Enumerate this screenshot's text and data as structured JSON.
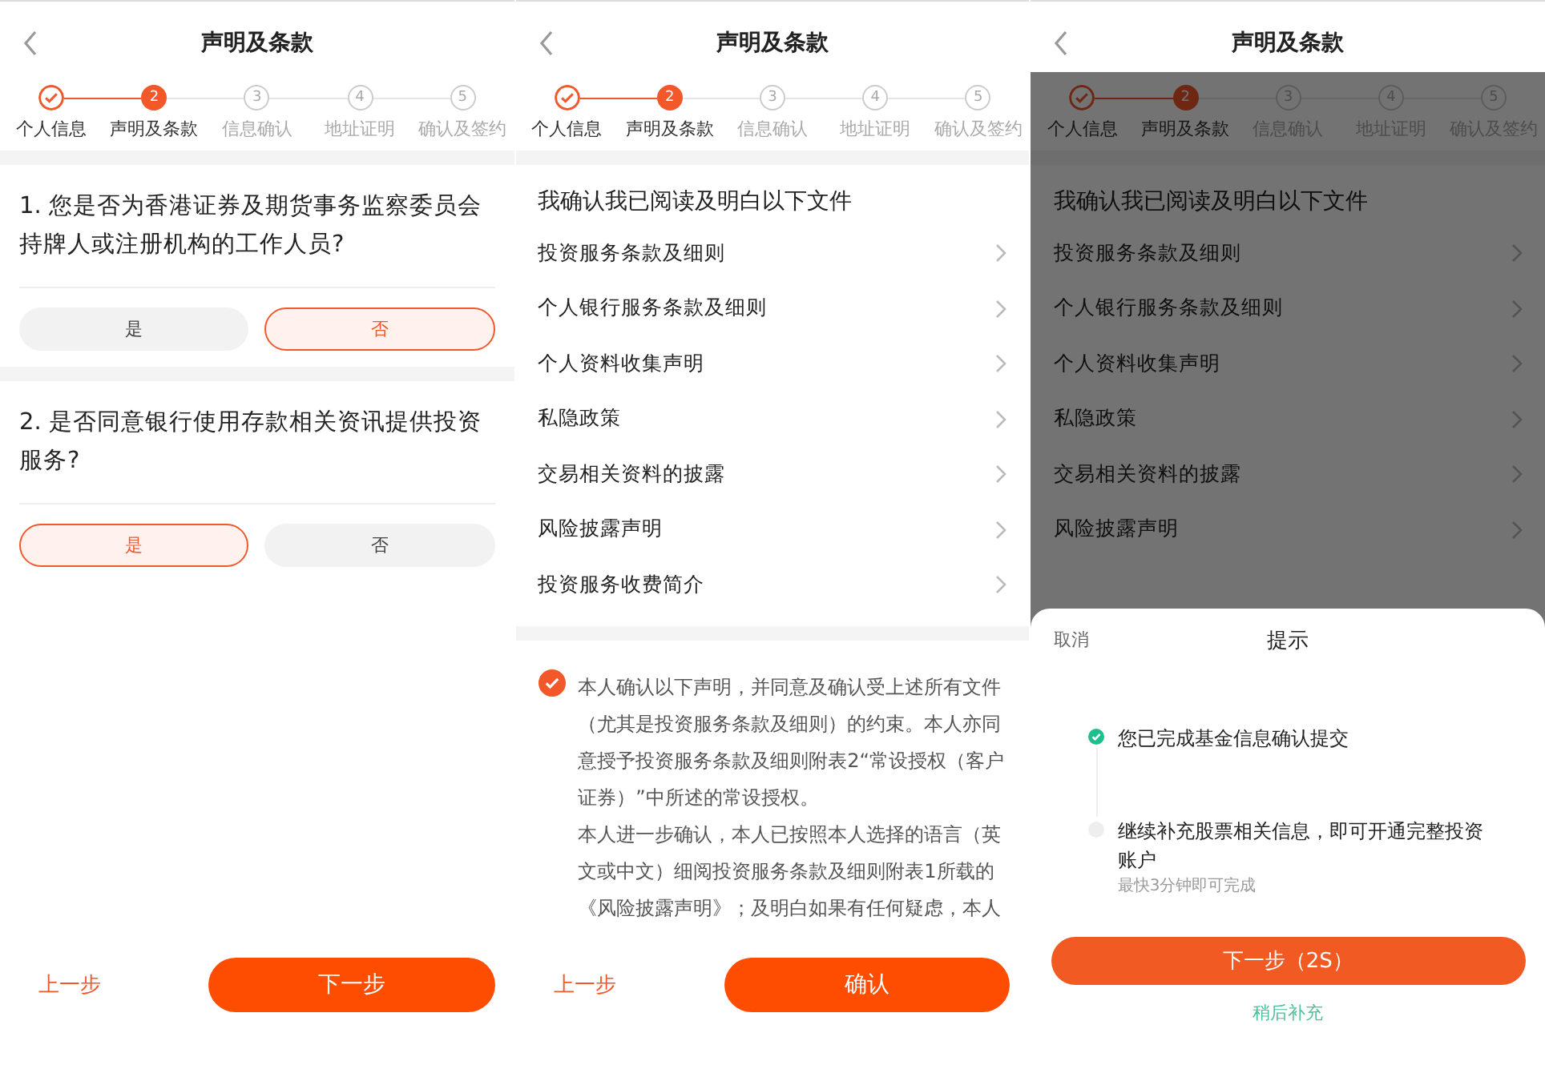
{
  "screens": [
    {
      "title": "声明及条款",
      "steps": [
        {
          "label": "个人信息",
          "completed": true,
          "selected": false
        },
        {
          "label": "声明及条款",
          "number": "2",
          "completed": false,
          "selected": true
        },
        {
          "label": "信息确认",
          "number": "3",
          "completed": false,
          "selected": false
        },
        {
          "label": "地址证明",
          "number": "4",
          "completed": false,
          "selected": false
        },
        {
          "label": "确认及签约",
          "number": "5",
          "completed": false,
          "selected": false
        }
      ],
      "body": {
        "kind": "questions",
        "questions": [
          {
            "text": "1. 您是否为香港证券及期货事务监察委员会持牌人或注册机构的工作人员?",
            "options": [
              {
                "label": "是",
                "selected": false
              },
              {
                "label": "否",
                "selected": true
              }
            ]
          },
          {
            "text": "2. 是否同意银行使用存款相关资讯提供投资服务?",
            "options": [
              {
                "label": "是",
                "selected": true
              },
              {
                "label": "否",
                "selected": false
              }
            ]
          }
        ]
      },
      "footer": {
        "back": "上一步",
        "next": "下一步"
      }
    },
    {
      "title": "声明及条款",
      "steps": [
        {
          "label": "个人信息",
          "completed": true,
          "selected": false
        },
        {
          "label": "声明及条款",
          "number": "2",
          "completed": false,
          "selected": true
        },
        {
          "label": "信息确认",
          "number": "3",
          "completed": false,
          "selected": false
        },
        {
          "label": "地址证明",
          "number": "4",
          "completed": false,
          "selected": false
        },
        {
          "label": "确认及签约",
          "number": "5",
          "completed": false,
          "selected": false
        }
      ],
      "body": {
        "kind": "documents",
        "heading": "我确认我已阅读及明白以下文件",
        "documents": [
          "投资服务条款及细则",
          "个人银行服务条款及细则",
          "个人资料收集声明",
          "私隐政策",
          "交易相关资料的披露",
          "风险披露声明",
          "投资服务收费简介"
        ],
        "consent": {
          "checked": true,
          "paragraphs": [
            "本人确认以下声明，并同意及确认受上述所有文件（尤其是投资服务条款及细则）的约束。本人亦同意授予投资服务条款及细则附表2“常设授权（客户证券）”中所述的常设授权。",
            "本人进一步确认，本人已按照本人选择的语言（英文或中文）细阅投资服务条款及细则附表1所载的《风险披露声明》；及明白如果有任何疑虑，本人"
          ]
        }
      },
      "footer": {
        "back": "上一步",
        "next": "确认"
      }
    },
    {
      "title": "声明及条款",
      "steps": [
        {
          "label": "个人信息",
          "completed": true,
          "selected": false
        },
        {
          "label": "声明及条款",
          "number": "2",
          "completed": false,
          "selected": true
        },
        {
          "label": "信息确认",
          "number": "3",
          "completed": false,
          "selected": false
        },
        {
          "label": "地址证明",
          "number": "4",
          "completed": false,
          "selected": false
        },
        {
          "label": "确认及签约",
          "number": "5",
          "completed": false,
          "selected": false
        }
      ],
      "body": {
        "kind": "documents",
        "heading": "我确认我已阅读及明白以下文件",
        "documents": [
          "投资服务条款及细则",
          "个人银行服务条款及细则",
          "个人资料收集声明",
          "私隐政策",
          "交易相关资料的披露",
          "风险披露声明"
        ]
      },
      "dialog": {
        "cancel": "取消",
        "title": "提示",
        "items": [
          {
            "text": "您已完成基金信息确认提交",
            "done": true
          },
          {
            "text": "继续补充股票相关信息，即可开通完整投资账户",
            "note": "最快3分钟即可完成",
            "done": false
          }
        ],
        "primary": "下一步（2S）",
        "secondary": "稍后补充"
      }
    }
  ]
}
